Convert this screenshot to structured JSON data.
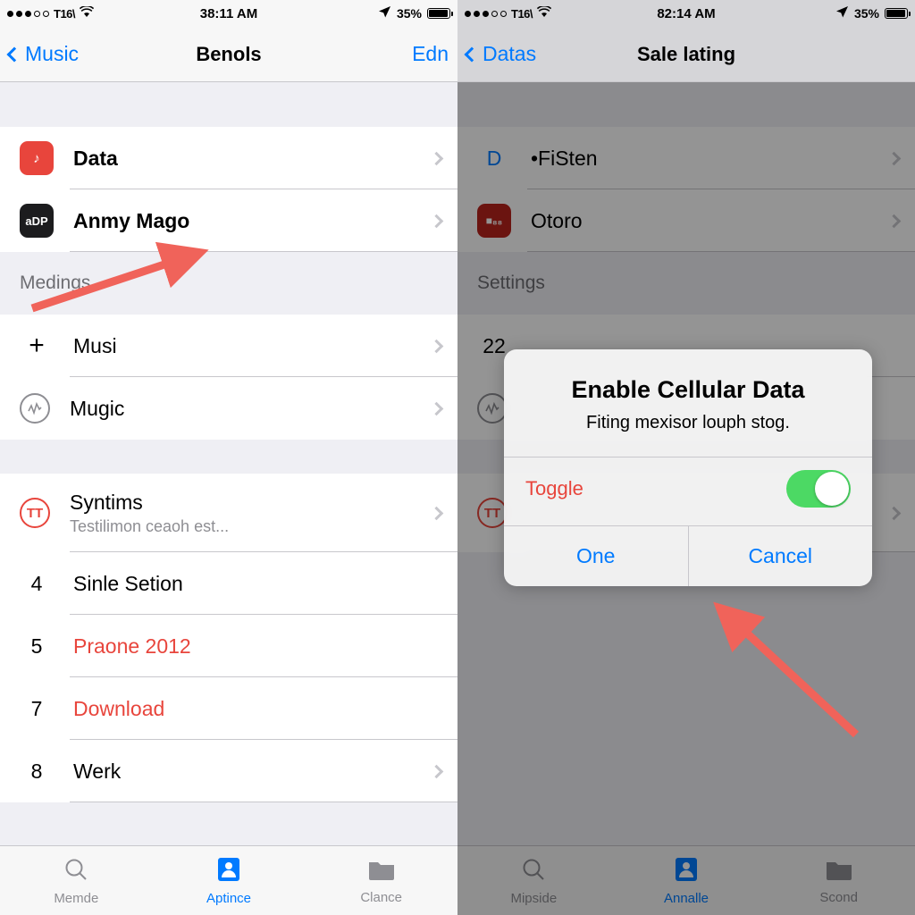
{
  "left": {
    "status": {
      "carrier": "T16\\",
      "time": "38:11 AM",
      "battery": "35%",
      "wifi_icon": "wifi-icon",
      "location_icon": "location-arrow-icon"
    },
    "nav": {
      "back": "Music",
      "title": "Benols",
      "action": "Edn"
    },
    "top_cells": [
      {
        "icon_label": "♪",
        "icon_color": "#e8453c",
        "label": "Data",
        "bold": true
      },
      {
        "icon_label": "aDP",
        "icon_color": "#1c1c1e",
        "label": "Anmy Mago",
        "bold": true
      }
    ],
    "section_header": "Medings",
    "mid_cells": [
      {
        "lead": "+",
        "label": "Musi"
      },
      {
        "lead": "icon-circle-wave",
        "label": "Mugic"
      }
    ],
    "lower_cells": [
      {
        "lead": "TT",
        "label": "Syntims",
        "sub": "Testilimon ceaoh est...",
        "lead_type": "circle-red"
      },
      {
        "lead": "4",
        "label": "Sinle Setion",
        "lead_type": "number"
      },
      {
        "lead": "5",
        "label": "Praone 2012",
        "lead_type": "number",
        "red": true
      },
      {
        "lead": "7",
        "label": "Download",
        "lead_type": "number",
        "red": true
      },
      {
        "lead": "8",
        "label": "Werk",
        "lead_type": "number"
      }
    ],
    "tabs": [
      {
        "label": "Memde",
        "icon": "search-icon",
        "active": false
      },
      {
        "label": "Aptince",
        "icon": "contact-card-icon",
        "active": true
      },
      {
        "label": "Clance",
        "icon": "folder-icon",
        "active": false
      }
    ]
  },
  "right": {
    "status": {
      "carrier": "T16\\",
      "time": "82:14 AM",
      "battery": "35%",
      "wifi_icon": "wifi-icon",
      "location_icon": "location-arrow-icon"
    },
    "nav": {
      "back": "Datas",
      "title": "Sale lating"
    },
    "top_cells": [
      {
        "icon_label": "D",
        "label": "•FiSten"
      },
      {
        "icon_label": "■₈₈",
        "label": "Otoro"
      }
    ],
    "section_header": "Settings",
    "mid_cells": [
      {
        "lead": "22",
        "label": ""
      },
      {
        "lead": "icon-circle-wave",
        "label": ""
      }
    ],
    "lower_cells": [
      {
        "lead": "TT",
        "label": ""
      }
    ],
    "tabs": [
      {
        "label": "Mipside",
        "icon": "search-icon",
        "active": false
      },
      {
        "label": "Annalle",
        "icon": "contact-card-icon",
        "active": true
      },
      {
        "label": "Scond",
        "icon": "folder-icon",
        "active": false
      }
    ],
    "alert": {
      "title": "Enable Cellular Data",
      "message": "Fiting mexisor louph stog.",
      "toggle_label": "Toggle",
      "toggle_on": true,
      "toggle_color": "#4cd964",
      "buttons": [
        "One",
        "Cancel"
      ]
    }
  },
  "annotations": {
    "arrow_color": "#f0635a",
    "arrow_left_target": "anmy-mago-cell",
    "arrow_right_target": "cancel-button"
  }
}
